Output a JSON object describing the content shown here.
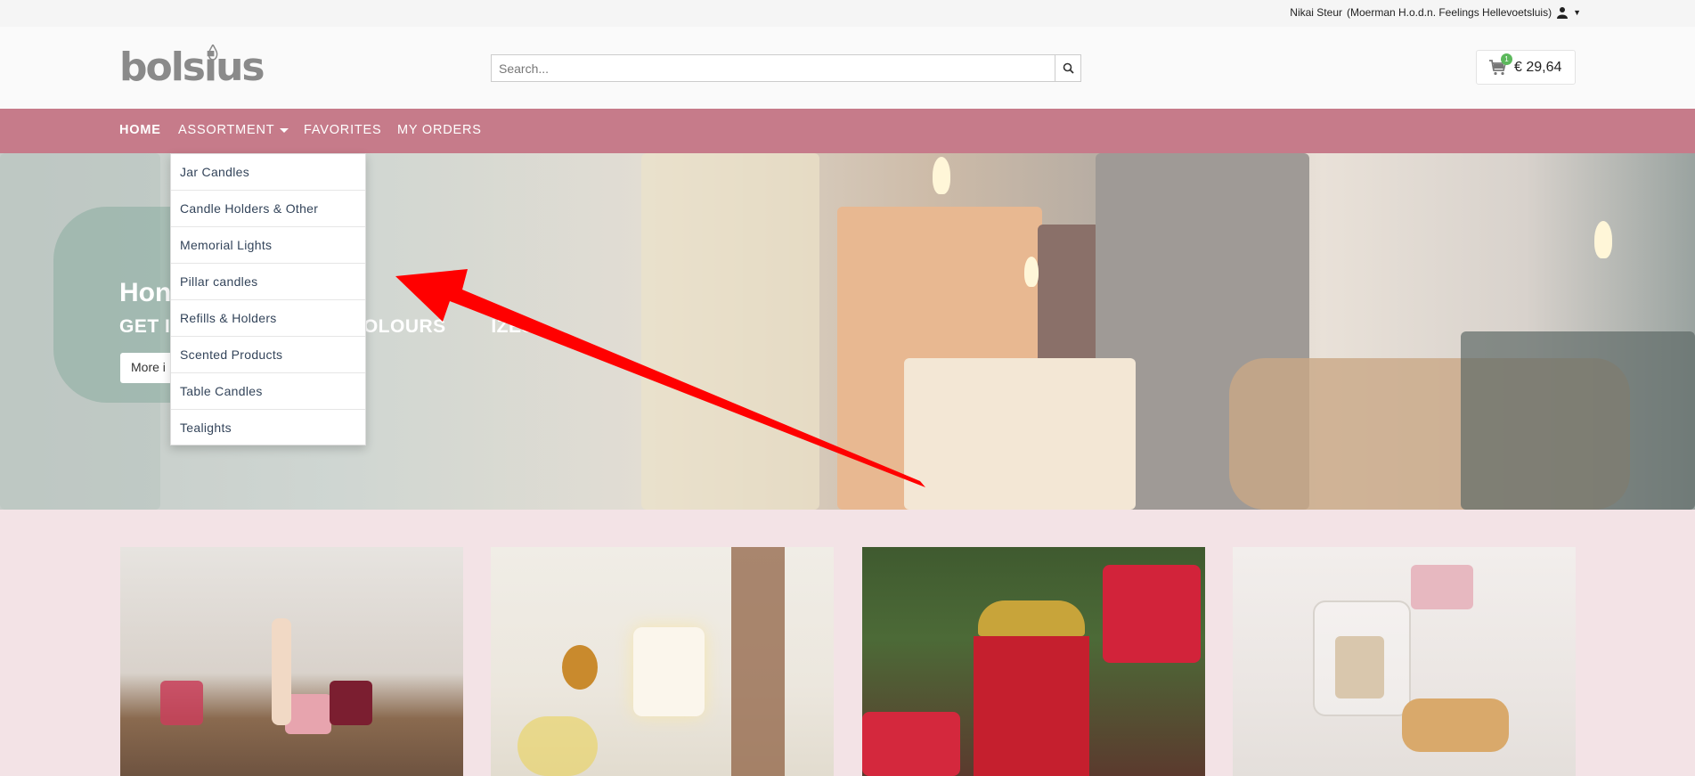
{
  "topbar": {
    "user_name": "Nikai Steur",
    "user_company": "(Moerman H.o.d.n. Feelings Hellevoetsluis)"
  },
  "header": {
    "logo_text": "bolsius",
    "search_placeholder": "Search...",
    "cart_count": "1",
    "cart_amount": "€ 29,64"
  },
  "nav": {
    "items": [
      {
        "label": "HOME"
      },
      {
        "label": "ASSORTMENT"
      },
      {
        "label": "FAVORITES"
      },
      {
        "label": "MY ORDERS"
      }
    ]
  },
  "dropdown": {
    "items": [
      {
        "label": "Jar Candles"
      },
      {
        "label": "Candle Holders & Other"
      },
      {
        "label": "Memorial Lights"
      },
      {
        "label": "Pillar candles"
      },
      {
        "label": "Refills & Holders"
      },
      {
        "label": "Scented Products"
      },
      {
        "label": "Table Candles"
      },
      {
        "label": "Tealights"
      }
    ]
  },
  "hero": {
    "title": "Hon",
    "subtitle": "GET I                          NY COLOURS        IZES",
    "button_label": "More i"
  },
  "colors": {
    "nav_bg": "#c67b8a",
    "page_bg": "#f3e3e6",
    "arrow": "#ff0000",
    "cart_badge": "#5cb85c"
  },
  "icons": {
    "user": "user-icon",
    "search": "search-icon",
    "cart": "cart-icon"
  }
}
